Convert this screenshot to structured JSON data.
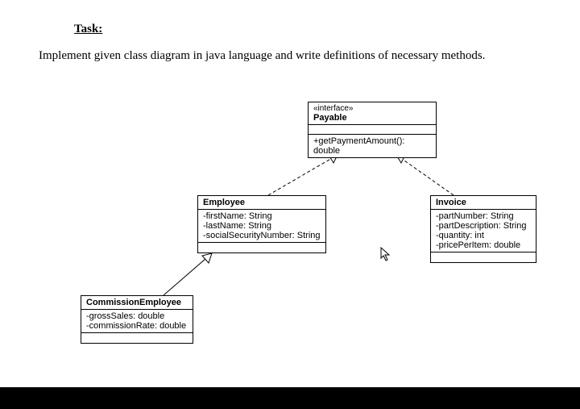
{
  "heading": "Task:",
  "instruction": "Implement given class diagram in java language and write definitions of necessary methods.",
  "payable": {
    "stereotype": "«interface»",
    "name": "Payable",
    "method": "+getPaymentAmount():  double"
  },
  "employee": {
    "name": "Employee",
    "a1": "-firstName: String",
    "a2": "-lastName: String",
    "a3": "-socialSecurityNumber: String"
  },
  "invoice": {
    "name": "Invoice",
    "a1": "-partNumber: String",
    "a2": "-partDescription: String",
    "a3": "-quantity: int",
    "a4": "-pricePerItem:  double"
  },
  "commission": {
    "name": "CommissionEmployee",
    "a1": "-grossSales: double",
    "a2": "-commissionRate:  double"
  },
  "chart_data": {
    "type": "uml-class-diagram",
    "entities": [
      {
        "kind": "interface",
        "name": "Payable",
        "operations": [
          "+getPaymentAmount(): double"
        ]
      },
      {
        "kind": "class",
        "name": "Employee",
        "attributes": [
          "-firstName: String",
          "-lastName: String",
          "-socialSecurityNumber: String"
        ]
      },
      {
        "kind": "class",
        "name": "Invoice",
        "attributes": [
          "-partNumber: String",
          "-partDescription: String",
          "-quantity: int",
          "-pricePerItem: double"
        ]
      },
      {
        "kind": "class",
        "name": "CommissionEmployee",
        "attributes": [
          "-grossSales: double",
          "-commissionRate: double"
        ]
      }
    ],
    "relationships": [
      {
        "from": "Employee",
        "to": "Payable",
        "type": "realization"
      },
      {
        "from": "Invoice",
        "to": "Payable",
        "type": "realization"
      },
      {
        "from": "CommissionEmployee",
        "to": "Employee",
        "type": "generalization"
      }
    ]
  }
}
